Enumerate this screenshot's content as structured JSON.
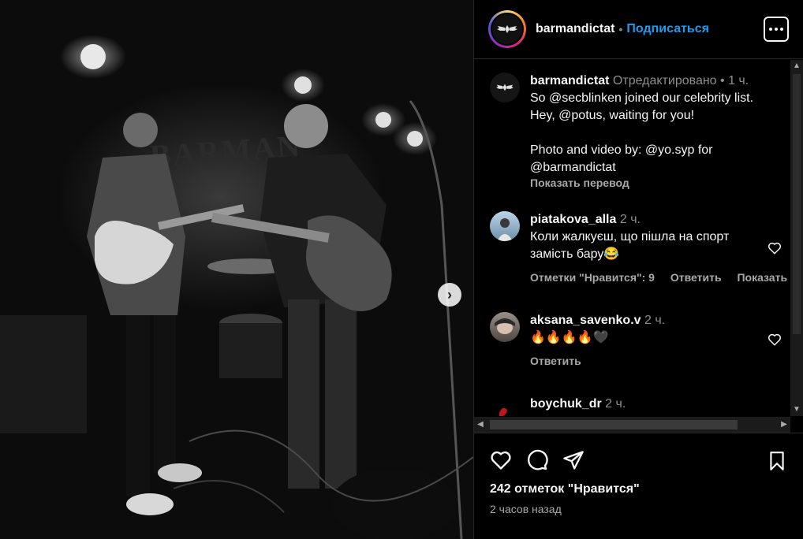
{
  "post": {
    "author": "barmandictat",
    "follow_label": "Подписаться",
    "dot": "•",
    "photo_banner_text": "BARMAN"
  },
  "comments": [
    {
      "user": "barmandictat",
      "meta": "Отредактировано •  1 ч.",
      "lines": [
        "So @secblinken joined our celebrity list.",
        "Hey, @potus, waiting for you!",
        "",
        "Photo and video by: @yo.syp for",
        "@barmandictat"
      ],
      "translate_label": "Показать перевод"
    },
    {
      "user": "piatakova_alla",
      "meta": "2 ч.",
      "text": "Коли жалкуєш, що пішла на спорт замість бару😂",
      "actions": [
        "Отметки \"Нравится\": 9",
        "Ответить",
        "Показать перевод"
      ]
    },
    {
      "user": "aksana_savenko.v",
      "meta": "2 ч.",
      "text": "🔥🔥🔥🔥🖤",
      "actions": [
        "Ответить"
      ]
    },
    {
      "user": "boychuk_dr",
      "meta": "2 ч.",
      "text": ""
    }
  ],
  "footer": {
    "likes": "242 отметок \"Нравится\"",
    "time": "2 часов назад"
  },
  "icons": {
    "like": "heart-icon",
    "comment": "comment-icon",
    "share": "paper-plane-icon",
    "save": "bookmark-icon",
    "more": "more-icon",
    "next": "chevron-right-icon"
  },
  "colors": {
    "accent": "#1a9cf0",
    "background": "#000000",
    "muted": "#a8a8a8"
  }
}
